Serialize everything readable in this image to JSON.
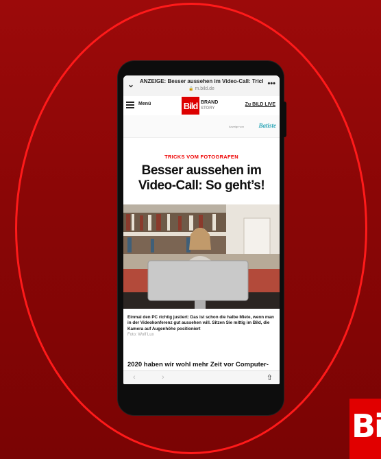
{
  "browser": {
    "page_title": "ANZEIGE: Besser aussehen im Video-Call: Trick...",
    "domain": "m.bild.de",
    "more_label": "•••"
  },
  "site_nav": {
    "menu_label": "Menü",
    "logo_text": "Bild",
    "brand_label": "BRAND",
    "brand_sub": "STORY",
    "live_link": "Zu BILD LIVE"
  },
  "sponsor": {
    "label": "Anzeige von",
    "brand": "Batiste"
  },
  "article": {
    "kicker": "TRICKS VOM FOTOGRAFEN",
    "headline": "Besser aussehen im Video-Call: So geht’s!",
    "caption": "Einmal den PC richtig justiert: Das ist schon die halbe Miete, wenn man in der Videokonferenz gut aussehen will. Sitzen Sie mittig im Bild, die Kamera auf Augenhöhe positioniert",
    "credit": "Foto: Wolf Lux",
    "body_start": "2020 haben wir wohl mehr Zeit vor Computer-"
  },
  "toolbar": {
    "back_icon": "‹",
    "forward_icon": "›",
    "share_icon": "⇧"
  },
  "corner_logo_text": "Bil",
  "colors": {
    "accent": "#e10000",
    "background": "#8a0606",
    "ring": "#ff1a1a",
    "sponsor": "#2ba5b6"
  }
}
